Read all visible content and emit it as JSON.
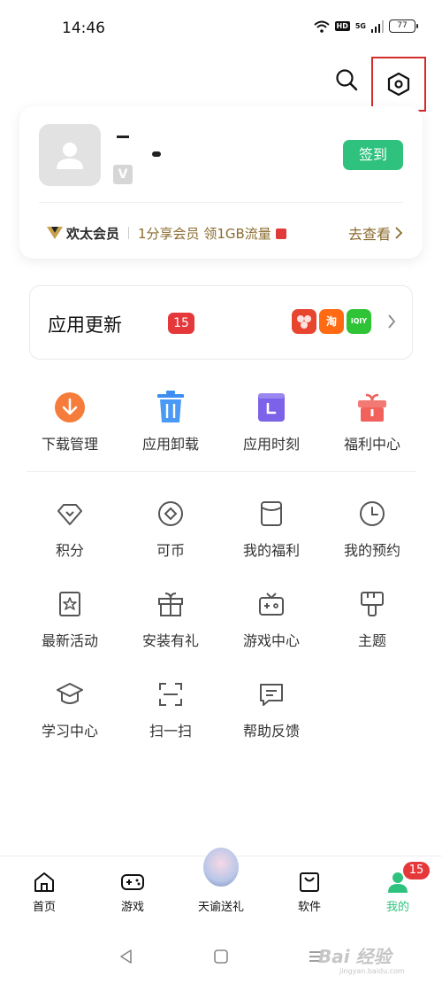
{
  "status_bar": {
    "time": "14:46",
    "hd": "HD",
    "signal": "5G",
    "battery": "77"
  },
  "profile": {
    "checkin_label": "签到",
    "vip_brand": "欢太会员",
    "vip_desc": "1分享会员 领1GB流量",
    "vip_link": "去查看"
  },
  "updates": {
    "title": "应用更新",
    "count": "15",
    "apps": [
      {
        "name": "weibo-like-app",
        "color": "#e8452f",
        "glyph": ""
      },
      {
        "name": "taobao",
        "color": "#ff6a13",
        "glyph": "淘"
      },
      {
        "name": "iqiyi",
        "color": "#2fc336",
        "glyph": "iQIY"
      }
    ]
  },
  "quick_actions": [
    {
      "label": "下载管理",
      "icon": "download-icon"
    },
    {
      "label": "应用卸载",
      "icon": "trash-icon"
    },
    {
      "label": "应用时刻",
      "icon": "app-moment-icon"
    },
    {
      "label": "福利中心",
      "icon": "gift-icon"
    }
  ],
  "services": [
    {
      "label": "积分",
      "icon": "diamond-icon"
    },
    {
      "label": "可币",
      "icon": "coin-icon"
    },
    {
      "label": "我的福利",
      "icon": "welfare-icon"
    },
    {
      "label": "我的预约",
      "icon": "clock-icon"
    },
    {
      "label": "最新活动",
      "icon": "activity-icon"
    },
    {
      "label": "安装有礼",
      "icon": "install-gift-icon"
    },
    {
      "label": "游戏中心",
      "icon": "game-center-icon"
    },
    {
      "label": "主题",
      "icon": "theme-icon"
    },
    {
      "label": "学习中心",
      "icon": "graduation-cap-icon"
    },
    {
      "label": "扫一扫",
      "icon": "scan-icon"
    },
    {
      "label": "帮助反馈",
      "icon": "feedback-icon"
    }
  ],
  "bottom_nav": [
    {
      "label": "首页",
      "icon": "home-icon"
    },
    {
      "label": "游戏",
      "icon": "gamepad-icon"
    },
    {
      "label": "天谕送礼",
      "icon": "character-avatar-icon"
    },
    {
      "label": "软件",
      "icon": "bag-icon"
    },
    {
      "label": "我的",
      "icon": "person-icon",
      "active": true,
      "badge": "15"
    }
  ],
  "watermark": {
    "text": "Bai 经验",
    "sub": "jingyan.baidu.com"
  },
  "colors": {
    "accent": "#2ec27e",
    "badge": "#e5383b",
    "vip_gold": "#8a6b2e",
    "highlight": "#d42b2b"
  }
}
